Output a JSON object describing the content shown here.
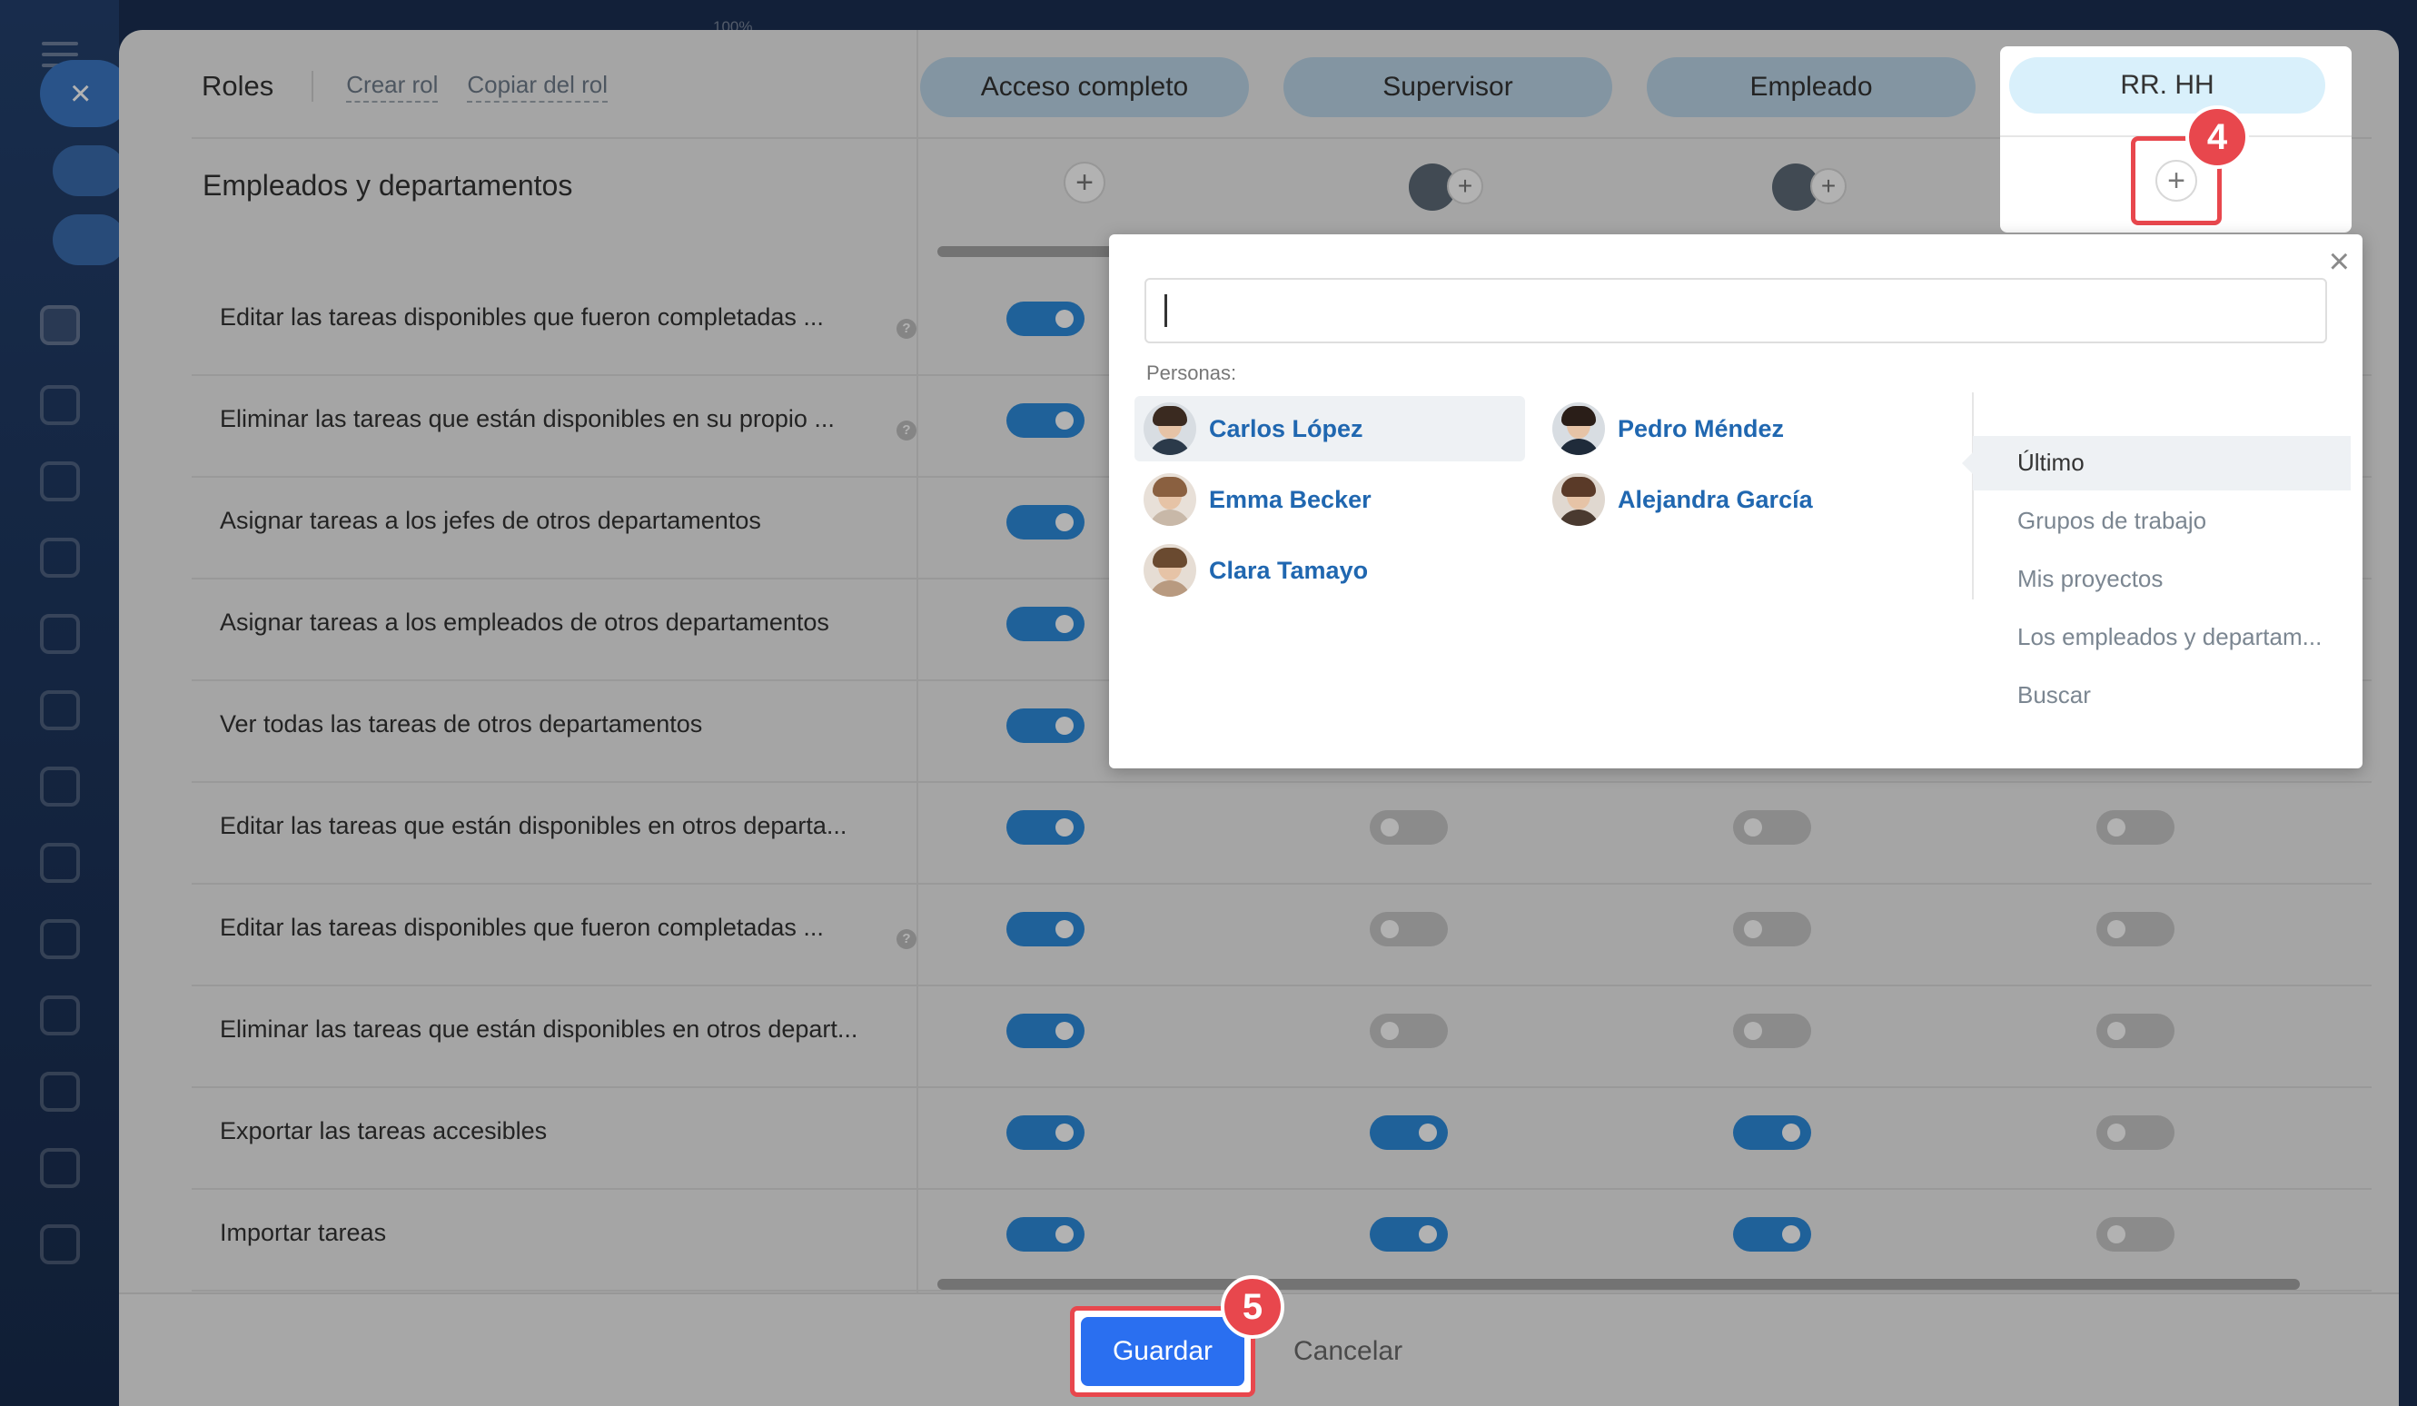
{
  "window": {
    "zoom_hint": "100%"
  },
  "header": {
    "title": "Roles",
    "create_role": "Crear rol",
    "copy_role": "Copiar del rol"
  },
  "section_title": "Empleados y departamentos",
  "roles": [
    "Acceso completo",
    "Supervisor",
    "Empleado",
    "RR. HH"
  ],
  "permissions": [
    {
      "label": "Editar las tareas disponibles que fueron completadas ...",
      "help": true,
      "values": [
        true,
        null,
        null,
        null
      ]
    },
    {
      "label": "Eliminar las tareas que están disponibles en su propio ...",
      "help": true,
      "values": [
        true,
        null,
        null,
        null
      ]
    },
    {
      "label": "Asignar tareas a los jefes de otros departamentos",
      "help": false,
      "values": [
        true,
        null,
        null,
        null
      ]
    },
    {
      "label": "Asignar tareas a los empleados de otros departamentos",
      "help": false,
      "values": [
        true,
        null,
        null,
        null
      ]
    },
    {
      "label": "Ver todas las tareas de otros departamentos",
      "help": false,
      "values": [
        true,
        null,
        null,
        null
      ]
    },
    {
      "label": "Editar las tareas que están disponibles en otros departa...",
      "help": false,
      "values": [
        true,
        false,
        false,
        false
      ]
    },
    {
      "label": "Editar las tareas disponibles que fueron completadas ...",
      "help": true,
      "values": [
        true,
        false,
        false,
        false
      ]
    },
    {
      "label": "Eliminar las tareas que están disponibles en otros depart...",
      "help": false,
      "values": [
        true,
        false,
        false,
        false
      ]
    },
    {
      "label": "Exportar las tareas accesibles",
      "help": false,
      "values": [
        true,
        true,
        true,
        false
      ]
    },
    {
      "label": "Importar tareas",
      "help": false,
      "values": [
        true,
        true,
        true,
        false
      ]
    }
  ],
  "popup": {
    "people_label": "Personas:",
    "people": [
      {
        "name": "Carlos López",
        "selected": true
      },
      {
        "name": "Pedro Méndez",
        "selected": false
      },
      {
        "name": "Emma Becker",
        "selected": false
      },
      {
        "name": "Alejandra García",
        "selected": false
      },
      {
        "name": "Clara Tamayo",
        "selected": false
      }
    ],
    "menu": [
      "Último",
      "Grupos de trabajo",
      "Mis proyectos",
      "Los empleados y departam...",
      "Buscar"
    ],
    "menu_active": "Último"
  },
  "footer": {
    "save": "Guardar",
    "cancel": "Cancelar"
  },
  "badges": {
    "step4": "4",
    "step5": "5"
  },
  "colors": {
    "accent": "#2a6ff0",
    "toggle_on": "#2d8bdc",
    "highlight": "#e8474d",
    "link": "#2067b0"
  }
}
